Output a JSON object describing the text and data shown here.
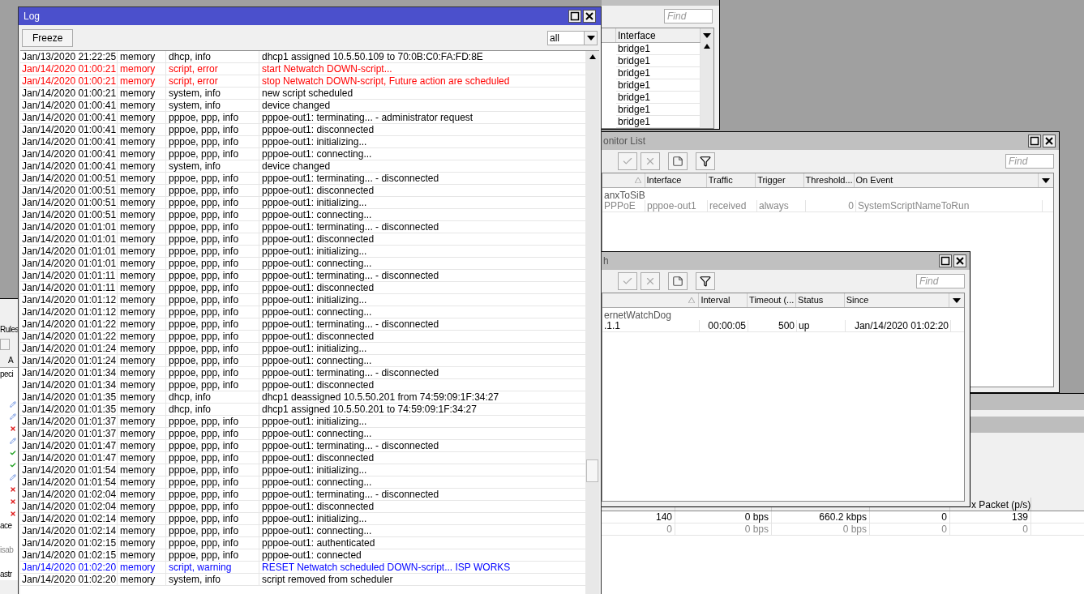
{
  "arp_window": {
    "find_placeholder": "Find",
    "columns": [
      "Interface"
    ],
    "rows": [
      "bridge1",
      "bridge1",
      "bridge1",
      "bridge1",
      "bridge1",
      "bridge1",
      "bridge1"
    ]
  },
  "interface_window": {
    "columns": [
      "",
      "",
      "",
      "",
      "x Packet (p/s)"
    ],
    "rows": [
      {
        "disabled": false,
        "cells": [
          "140",
          "0 bps",
          "660.2 kbps",
          "0",
          "139"
        ]
      },
      {
        "disabled": true,
        "cells": [
          "0",
          "0 bps",
          "0 bps",
          "0",
          "0"
        ]
      }
    ]
  },
  "traffic_monitor_window": {
    "title": "onitor List",
    "find_placeholder": "Find",
    "columns": [
      "Interface",
      "Traffic",
      "Trigger",
      "Threshold...",
      "On Event"
    ],
    "rows": [
      {
        "kind": "comment",
        "text": "anxToSiB"
      },
      {
        "kind": "item",
        "disabled": true,
        "cells": [
          "PPPoE",
          "pppoe-out1",
          "received",
          "always",
          "0",
          "SystemScriptNameToRun"
        ]
      }
    ]
  },
  "netwatch_window": {
    "title": "h",
    "find_placeholder": "Find",
    "columns": [
      "Interval",
      "Timeout (...",
      "Status",
      "Since"
    ],
    "rows": [
      {
        "kind": "comment",
        "text": "ernetWatchDog"
      },
      {
        "kind": "item",
        "disabled": false,
        "cells": [
          ".1.1",
          "00:00:05",
          "500",
          "up",
          "Jan/14/2020 01:02:20"
        ]
      }
    ]
  },
  "rules_window": {
    "title": "Rules",
    "column": "A",
    "texts": [
      "peci",
      "ace",
      "isab",
      "astr"
    ],
    "icons": [
      {
        "kind": "edit"
      },
      {
        "kind": "edit"
      },
      {
        "kind": "error"
      },
      {
        "kind": "edit"
      },
      {
        "kind": "ok"
      },
      {
        "kind": "ok"
      },
      {
        "kind": "edit"
      },
      {
        "kind": "error"
      },
      {
        "kind": "error"
      },
      {
        "kind": "error"
      }
    ]
  },
  "log_window": {
    "title": "Log",
    "freeze_button": "Freeze",
    "filter": "all",
    "rows": [
      {
        "time": "Jan/13/2020 21:22:25",
        "buffer": "memory",
        "topics": "dhcp, info",
        "message": "dhcp1 assigned 10.5.50.109 to 70:0B:C0:FA:FD:8E",
        "kind": "info"
      },
      {
        "time": "Jan/14/2020 01:00:21",
        "buffer": "memory",
        "topics": "script, error",
        "message": "start Netwatch DOWN-script...",
        "kind": "error"
      },
      {
        "time": "Jan/14/2020 01:00:21",
        "buffer": "memory",
        "topics": "script, error",
        "message": "stop Netwatch DOWN-script, Future action are scheduled",
        "kind": "error"
      },
      {
        "time": "Jan/14/2020 01:00:21",
        "buffer": "memory",
        "topics": "system, info",
        "message": "new script scheduled",
        "kind": "info"
      },
      {
        "time": "Jan/14/2020 01:00:41",
        "buffer": "memory",
        "topics": "system, info",
        "message": "device changed",
        "kind": "info"
      },
      {
        "time": "Jan/14/2020 01:00:41",
        "buffer": "memory",
        "topics": "pppoe, ppp, info",
        "message": "pppoe-out1: terminating... - administrator request",
        "kind": "info"
      },
      {
        "time": "Jan/14/2020 01:00:41",
        "buffer": "memory",
        "topics": "pppoe, ppp, info",
        "message": "pppoe-out1: disconnected",
        "kind": "info"
      },
      {
        "time": "Jan/14/2020 01:00:41",
        "buffer": "memory",
        "topics": "pppoe, ppp, info",
        "message": "pppoe-out1: initializing...",
        "kind": "info"
      },
      {
        "time": "Jan/14/2020 01:00:41",
        "buffer": "memory",
        "topics": "pppoe, ppp, info",
        "message": "pppoe-out1: connecting...",
        "kind": "info"
      },
      {
        "time": "Jan/14/2020 01:00:41",
        "buffer": "memory",
        "topics": "system, info",
        "message": "device changed",
        "kind": "info"
      },
      {
        "time": "Jan/14/2020 01:00:51",
        "buffer": "memory",
        "topics": "pppoe, ppp, info",
        "message": "pppoe-out1: terminating... - disconnected",
        "kind": "info"
      },
      {
        "time": "Jan/14/2020 01:00:51",
        "buffer": "memory",
        "topics": "pppoe, ppp, info",
        "message": "pppoe-out1: disconnected",
        "kind": "info"
      },
      {
        "time": "Jan/14/2020 01:00:51",
        "buffer": "memory",
        "topics": "pppoe, ppp, info",
        "message": "pppoe-out1: initializing...",
        "kind": "info"
      },
      {
        "time": "Jan/14/2020 01:00:51",
        "buffer": "memory",
        "topics": "pppoe, ppp, info",
        "message": "pppoe-out1: connecting...",
        "kind": "info"
      },
      {
        "time": "Jan/14/2020 01:01:01",
        "buffer": "memory",
        "topics": "pppoe, ppp, info",
        "message": "pppoe-out1: terminating... - disconnected",
        "kind": "info"
      },
      {
        "time": "Jan/14/2020 01:01:01",
        "buffer": "memory",
        "topics": "pppoe, ppp, info",
        "message": "pppoe-out1: disconnected",
        "kind": "info"
      },
      {
        "time": "Jan/14/2020 01:01:01",
        "buffer": "memory",
        "topics": "pppoe, ppp, info",
        "message": "pppoe-out1: initializing...",
        "kind": "info"
      },
      {
        "time": "Jan/14/2020 01:01:01",
        "buffer": "memory",
        "topics": "pppoe, ppp, info",
        "message": "pppoe-out1: connecting...",
        "kind": "info"
      },
      {
        "time": "Jan/14/2020 01:01:11",
        "buffer": "memory",
        "topics": "pppoe, ppp, info",
        "message": "pppoe-out1: terminating... - disconnected",
        "kind": "info"
      },
      {
        "time": "Jan/14/2020 01:01:11",
        "buffer": "memory",
        "topics": "pppoe, ppp, info",
        "message": "pppoe-out1: disconnected",
        "kind": "info"
      },
      {
        "time": "Jan/14/2020 01:01:12",
        "buffer": "memory",
        "topics": "pppoe, ppp, info",
        "message": "pppoe-out1: initializing...",
        "kind": "info"
      },
      {
        "time": "Jan/14/2020 01:01:12",
        "buffer": "memory",
        "topics": "pppoe, ppp, info",
        "message": "pppoe-out1: connecting...",
        "kind": "info"
      },
      {
        "time": "Jan/14/2020 01:01:22",
        "buffer": "memory",
        "topics": "pppoe, ppp, info",
        "message": "pppoe-out1: terminating... - disconnected",
        "kind": "info"
      },
      {
        "time": "Jan/14/2020 01:01:22",
        "buffer": "memory",
        "topics": "pppoe, ppp, info",
        "message": "pppoe-out1: disconnected",
        "kind": "info"
      },
      {
        "time": "Jan/14/2020 01:01:24",
        "buffer": "memory",
        "topics": "pppoe, ppp, info",
        "message": "pppoe-out1: initializing...",
        "kind": "info"
      },
      {
        "time": "Jan/14/2020 01:01:24",
        "buffer": "memory",
        "topics": "pppoe, ppp, info",
        "message": "pppoe-out1: connecting...",
        "kind": "info"
      },
      {
        "time": "Jan/14/2020 01:01:34",
        "buffer": "memory",
        "topics": "pppoe, ppp, info",
        "message": "pppoe-out1: terminating... - disconnected",
        "kind": "info"
      },
      {
        "time": "Jan/14/2020 01:01:34",
        "buffer": "memory",
        "topics": "pppoe, ppp, info",
        "message": "pppoe-out1: disconnected",
        "kind": "info"
      },
      {
        "time": "Jan/14/2020 01:01:35",
        "buffer": "memory",
        "topics": "dhcp, info",
        "message": "dhcp1 deassigned 10.5.50.201 from 74:59:09:1F:34:27",
        "kind": "info"
      },
      {
        "time": "Jan/14/2020 01:01:35",
        "buffer": "memory",
        "topics": "dhcp, info",
        "message": "dhcp1 assigned 10.5.50.201 to 74:59:09:1F:34:27",
        "kind": "info"
      },
      {
        "time": "Jan/14/2020 01:01:37",
        "buffer": "memory",
        "topics": "pppoe, ppp, info",
        "message": "pppoe-out1: initializing...",
        "kind": "info"
      },
      {
        "time": "Jan/14/2020 01:01:37",
        "buffer": "memory",
        "topics": "pppoe, ppp, info",
        "message": "pppoe-out1: connecting...",
        "kind": "info"
      },
      {
        "time": "Jan/14/2020 01:01:47",
        "buffer": "memory",
        "topics": "pppoe, ppp, info",
        "message": "pppoe-out1: terminating... - disconnected",
        "kind": "info"
      },
      {
        "time": "Jan/14/2020 01:01:47",
        "buffer": "memory",
        "topics": "pppoe, ppp, info",
        "message": "pppoe-out1: disconnected",
        "kind": "info"
      },
      {
        "time": "Jan/14/2020 01:01:54",
        "buffer": "memory",
        "topics": "pppoe, ppp, info",
        "message": "pppoe-out1: initializing...",
        "kind": "info"
      },
      {
        "time": "Jan/14/2020 01:01:54",
        "buffer": "memory",
        "topics": "pppoe, ppp, info",
        "message": "pppoe-out1: connecting...",
        "kind": "info"
      },
      {
        "time": "Jan/14/2020 01:02:04",
        "buffer": "memory",
        "topics": "pppoe, ppp, info",
        "message": "pppoe-out1: terminating... - disconnected",
        "kind": "info"
      },
      {
        "time": "Jan/14/2020 01:02:04",
        "buffer": "memory",
        "topics": "pppoe, ppp, info",
        "message": "pppoe-out1: disconnected",
        "kind": "info"
      },
      {
        "time": "Jan/14/2020 01:02:14",
        "buffer": "memory",
        "topics": "pppoe, ppp, info",
        "message": "pppoe-out1: initializing...",
        "kind": "info"
      },
      {
        "time": "Jan/14/2020 01:02:14",
        "buffer": "memory",
        "topics": "pppoe, ppp, info",
        "message": "pppoe-out1: connecting...",
        "kind": "info"
      },
      {
        "time": "Jan/14/2020 01:02:15",
        "buffer": "memory",
        "topics": "pppoe, ppp, info",
        "message": "pppoe-out1: authenticated",
        "kind": "info"
      },
      {
        "time": "Jan/14/2020 01:02:15",
        "buffer": "memory",
        "topics": "pppoe, ppp, info",
        "message": "pppoe-out1: connected",
        "kind": "info"
      },
      {
        "time": "Jan/14/2020 01:02:20",
        "buffer": "memory",
        "topics": "script, warning",
        "message": "RESET Netwatch scheduled DOWN-script... ISP WORKS",
        "kind": "warning"
      },
      {
        "time": "Jan/14/2020 01:02:20",
        "buffer": "memory",
        "topics": "system, info",
        "message": "script removed from scheduler",
        "kind": "info"
      }
    ]
  }
}
